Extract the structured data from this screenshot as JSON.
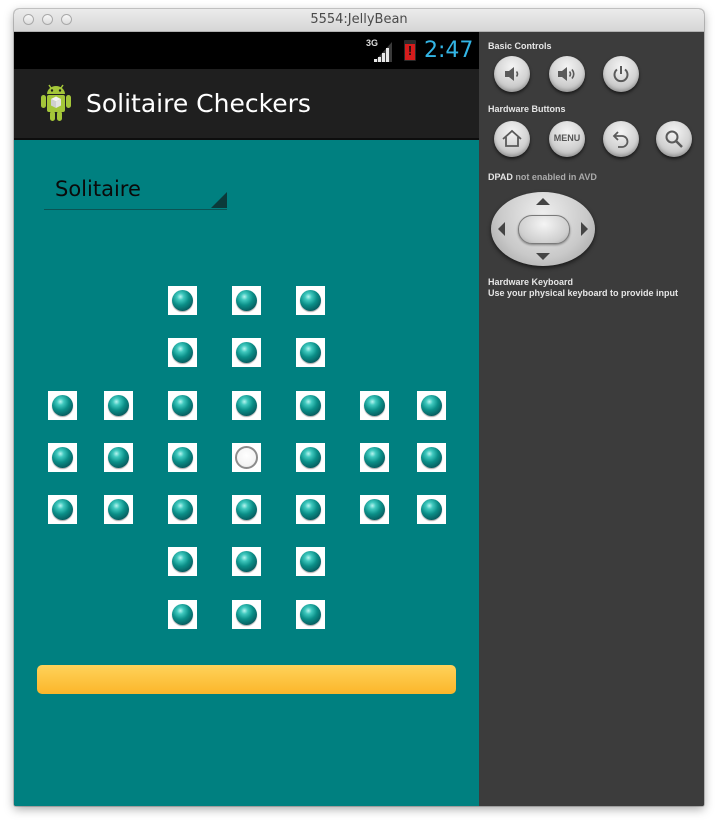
{
  "window": {
    "title": "5554:JellyBean"
  },
  "status_bar": {
    "network": "3G",
    "time": "2:47",
    "battery_warning": "!"
  },
  "action_bar": {
    "app_title": "Solitaire Checkers"
  },
  "game_selector": {
    "selected": "Solitaire"
  },
  "board": {
    "peg_color": "#0b8f88",
    "empty_hole_label": "empty hole",
    "rows": [
      [
        "",
        "",
        "peg",
        "peg",
        "peg",
        "",
        ""
      ],
      [
        "",
        "",
        "peg",
        "peg",
        "peg",
        "",
        ""
      ],
      [
        "peg",
        "peg",
        "peg",
        "peg",
        "peg",
        "peg",
        "peg"
      ],
      [
        "peg",
        "peg",
        "peg",
        "empty",
        "peg",
        "peg",
        "peg"
      ],
      [
        "peg",
        "peg",
        "peg",
        "peg",
        "peg",
        "peg",
        "peg"
      ],
      [
        "",
        "",
        "peg",
        "peg",
        "peg",
        "",
        ""
      ],
      [
        "",
        "",
        "peg",
        "peg",
        "peg",
        "",
        ""
      ]
    ]
  },
  "action_button": {
    "label": "",
    "color": "#fbb62a"
  },
  "emulator_controls": {
    "basic_controls_label": "Basic Controls",
    "hardware_buttons_label": "Hardware Buttons",
    "menu_label": "MENU",
    "dpad_label": "DPAD",
    "dpad_note": "not enabled in AVD",
    "keyboard_label": "Hardware Keyboard",
    "keyboard_note": "Use your physical keyboard to provide input"
  },
  "colors": {
    "screen_background": "#008080",
    "clock": "#33b5e5",
    "panel_background": "#3c3c3c"
  }
}
